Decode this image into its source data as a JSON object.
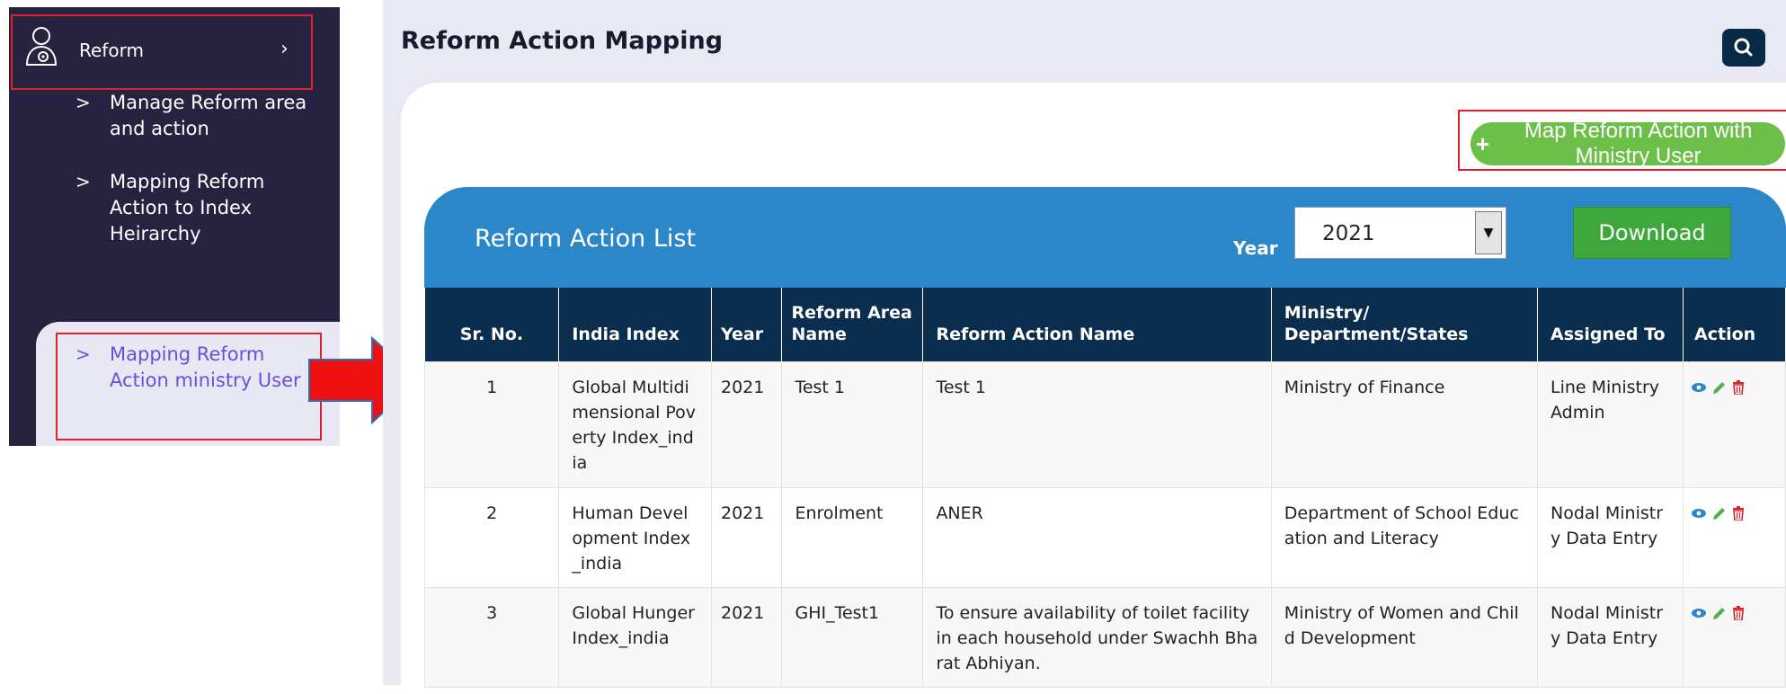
{
  "sidebar": {
    "reform_label": "Reform",
    "reform_chevron": "›",
    "items": [
      {
        "label": "Manage Reform area and action",
        "active": false
      },
      {
        "label": "Mapping Reform Action to Index Heirarchy",
        "active": false
      },
      {
        "label": "Mapping Reform Action ministry User",
        "active": true
      }
    ]
  },
  "header": {
    "title": "Reform Action Mapping",
    "search_icon": "search-icon"
  },
  "map_button": {
    "icon": "plus",
    "label": "Map Reform Action with Ministry User"
  },
  "list": {
    "title": "Reform Action List",
    "year_label": "Year",
    "year_value": "2021",
    "download_label": "Download"
  },
  "table": {
    "columns": [
      "Sr. No.",
      "India Index",
      "Year",
      "Reform Area Name",
      "Reform Action Name",
      "Ministry/ Department/States",
      "Assigned To",
      "Action"
    ],
    "rows": [
      {
        "sr": "1",
        "index": "Global Multidimensional Poverty Index_india",
        "year": "2021",
        "area": "Test 1",
        "action": "Test 1",
        "ministry": "Ministry of Finance",
        "assigned": "Line Ministry Admin"
      },
      {
        "sr": "2",
        "index": "Human Development Index_india",
        "year": "2021",
        "area": "Enrolment",
        "action": "ANER",
        "ministry": "Department of School Education and Literacy",
        "assigned": "Nodal Ministry Data Entry"
      },
      {
        "sr": "3",
        "index": "Global Hunger Index_india",
        "year": "2021",
        "area": "GHI_Test1",
        "action": "To ensure availability of toilet facility in each household under Swachh Bharat Abhiyan.",
        "ministry": "Ministry of Women and Child Development",
        "assigned": "Nodal Ministry Data Entry"
      }
    ]
  },
  "colors": {
    "sidebar_bg": "#272240",
    "accent_purple": "#6a4fd8",
    "highlight_red": "#e0212c",
    "list_header_blue": "#2c87c8",
    "table_header": "#0b2d4e",
    "map_button_green": "#6cc04a",
    "download_green": "#3fa83d",
    "view_icon": "#2c87c8",
    "edit_icon": "#4caf50",
    "delete_icon": "#e0212c"
  }
}
